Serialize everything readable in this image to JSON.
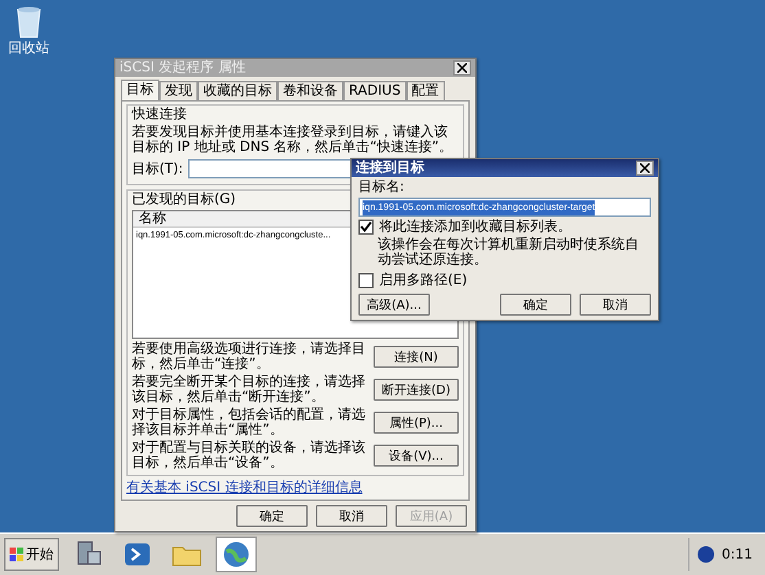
{
  "desktop_icons": [
    {
      "label": "回收站"
    }
  ],
  "properties_dialog": {
    "title": "iSCSI 发起程序 属性",
    "tabs": [
      {
        "label": "目标",
        "selected": true
      },
      {
        "label": "发现",
        "selected": false
      },
      {
        "label": "收藏的目标",
        "selected": false
      },
      {
        "label": "卷和设备",
        "selected": false
      },
      {
        "label": "RADIUS",
        "selected": false
      },
      {
        "label": "配置",
        "selected": false
      }
    ],
    "quick_connect": {
      "heading": "快速连接",
      "description": "若要发现目标并使用基本连接登录到目标，请键入该目标的 IP 地址或 DNS 名称，然后单击“快速连接”。",
      "target_label": "目标(T):"
    },
    "discovered_targets": {
      "heading": "已发现的目标(G)",
      "columns": [
        "名称"
      ],
      "rows": [
        {
          "name": "iqn.1991-05.com.microsoft:dc-zhangcongcluste...",
          "selected": false
        }
      ]
    },
    "actions": [
      {
        "description": "若要使用高级选项进行连接，请选择目标，然后单击“连接”。",
        "button": "连接(N)"
      },
      {
        "description": "若要完全断开某个目标的连接，请选择该目标，然后单击“断开连接”。",
        "button": "断开连接(D)"
      },
      {
        "description": "对于目标属性，包括会话的配置，请选择该目标并单击“属性”。",
        "button": "属性(P)..."
      },
      {
        "description": "对于配置与目标关联的设备，请选择该目标，然后单击“设备”。",
        "button": "设备(V)..."
      }
    ],
    "help_link": "有关基本 iSCSI 连接和目标的详细信息",
    "buttons": [
      {
        "label": "确定",
        "disabled": false
      },
      {
        "label": "取消",
        "disabled": false
      },
      {
        "label": "应用(A)",
        "disabled": true
      }
    ]
  },
  "connect_dialog": {
    "title": "连接到目标",
    "target_name_label": "目标名:",
    "target_name_value": "iqn.1991-05.com.microsoft:dc-zhangcongcluster-target",
    "options": [
      {
        "label": "将此连接添加到收藏目标列表。",
        "checked": true,
        "note": "该操作会在每次计算机重新启动时使系统自动尝试还原连接。"
      },
      {
        "label": "启用多路径(E)",
        "checked": false
      }
    ],
    "buttons": [
      "高级(A)...",
      "确定",
      "取消"
    ]
  },
  "taskbar": {
    "start_label": "开始",
    "apps": [
      {
        "kind": "server",
        "selected": false
      },
      {
        "kind": "shell",
        "selected": false
      },
      {
        "kind": "folder",
        "selected": false
      },
      {
        "kind": "globe",
        "selected": true
      }
    ],
    "clock": "0:11"
  }
}
